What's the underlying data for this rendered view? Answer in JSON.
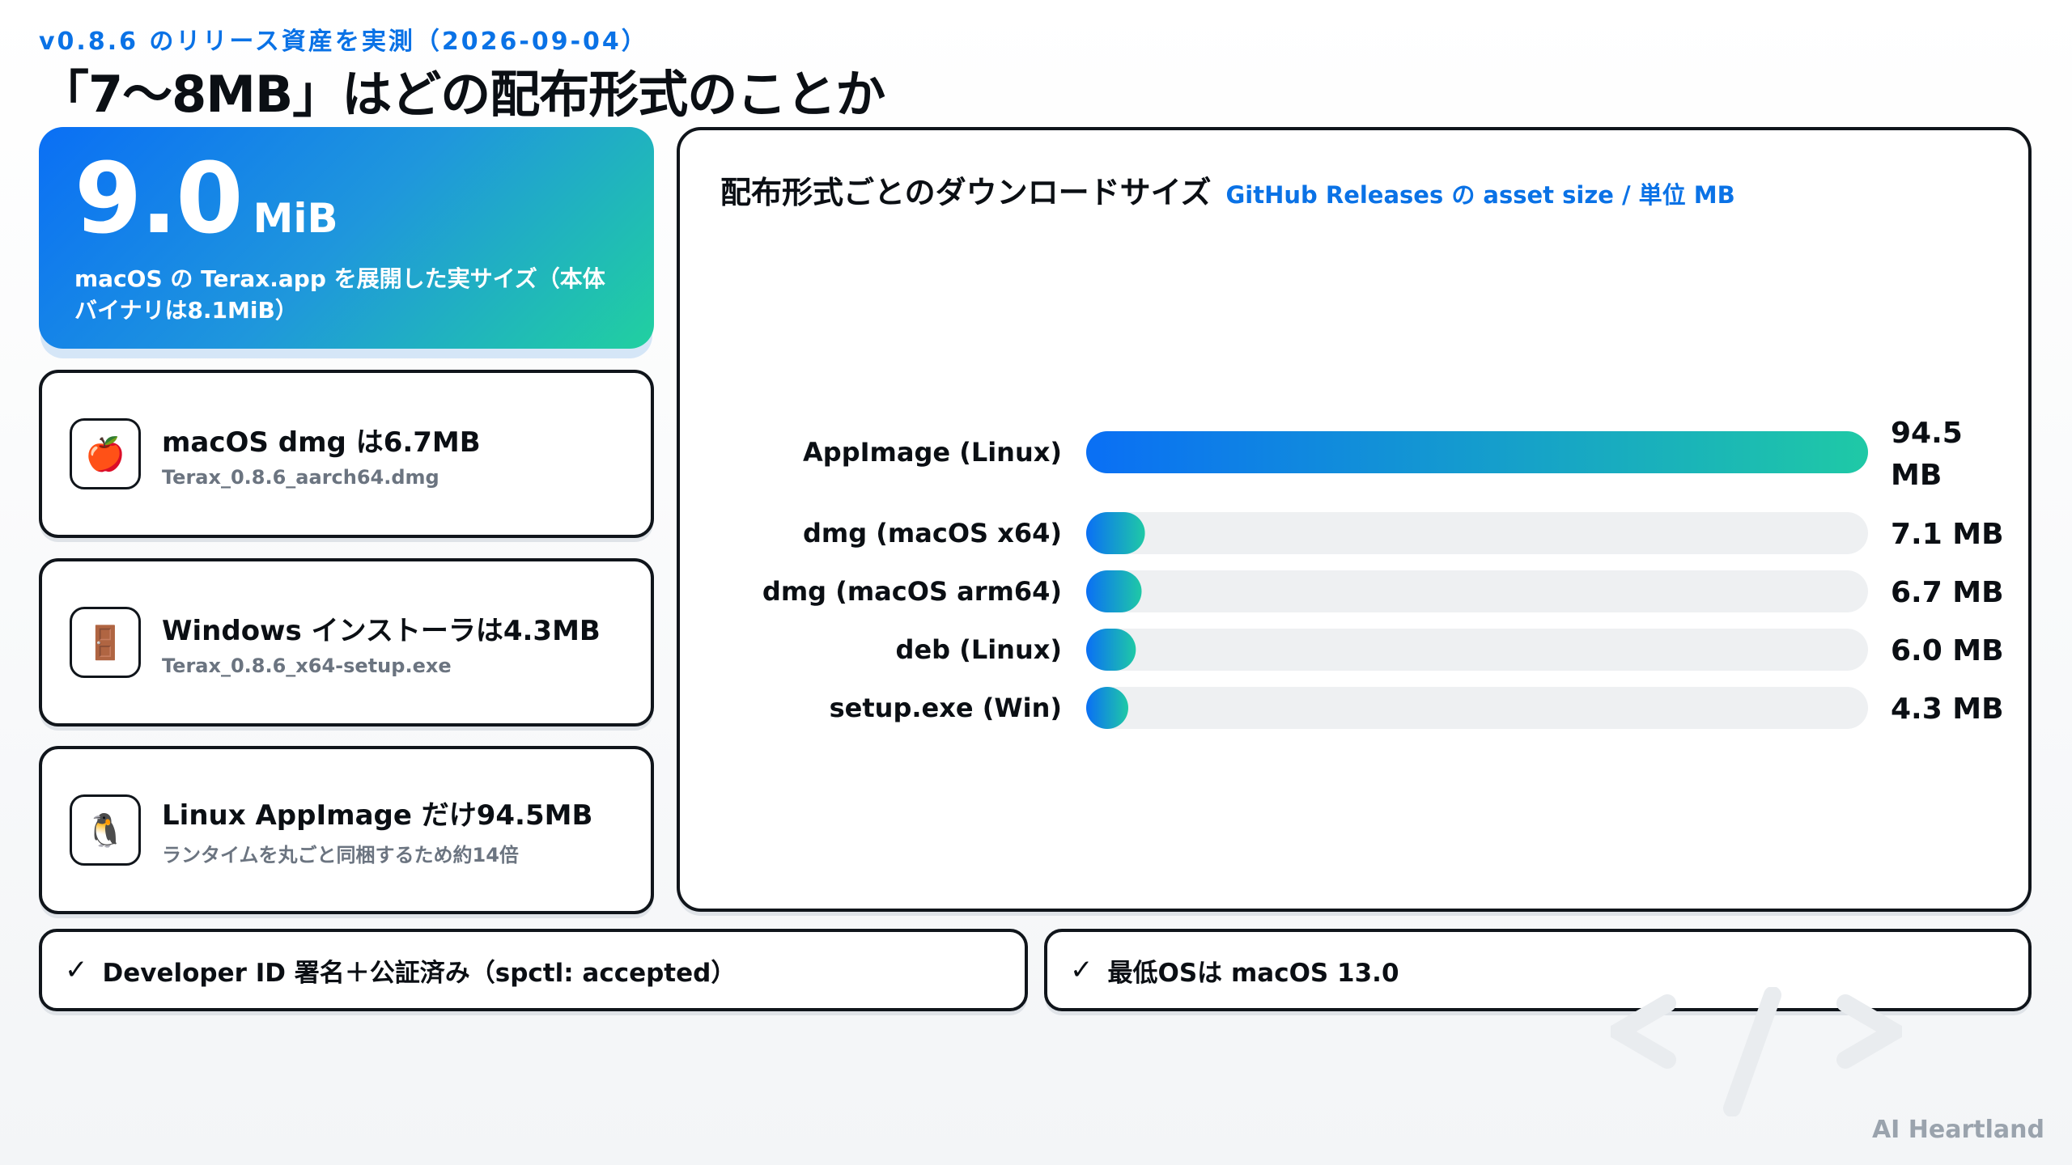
{
  "header": {
    "eyebrow": "v0.8.6 のリリース資産を実測（2026-09-04）",
    "title": "「7〜8MB」はどの配布形式のことか"
  },
  "hero": {
    "value": "9.0",
    "unit": "MiB",
    "description": "macOS の Terax.app を展開した実サイズ（本体バイナリは8.1MiB）"
  },
  "facts": [
    {
      "icon": "apple-icon",
      "glyph": "🍎",
      "title": "macOS dmg は6.7MB",
      "subtitle": "Terax_0.8.6_aarch64.dmg"
    },
    {
      "icon": "window-icon",
      "glyph": "🚪",
      "title": "Windows インストーラは4.3MB",
      "subtitle": "Terax_0.8.6_x64-setup.exe"
    },
    {
      "icon": "penguin-icon",
      "glyph": "🐧",
      "title": "Linux AppImage だけ94.5MB",
      "subtitle": "ランタイムを丸ごと同梱するため約14倍"
    }
  ],
  "panel": {
    "title": "配布形式ごとのダウンロードサイズ",
    "subtitle": "GitHub Releases の asset size / 単位 MB"
  },
  "chart_data": {
    "type": "bar",
    "orientation": "horizontal",
    "categories": [
      "AppImage (Linux)",
      "dmg (macOS x64)",
      "dmg (macOS arm64)",
      "deb (Linux)",
      "setup.exe (Win)"
    ],
    "values": [
      94.5,
      7.1,
      6.7,
      6.0,
      4.3
    ],
    "value_labels": [
      "94.5 MB",
      "7.1 MB",
      "6.7 MB",
      "6.0 MB",
      "4.3 MB"
    ],
    "unit": "MB",
    "xlim": [
      0,
      94.5
    ],
    "grid": false,
    "colors": {
      "start": "#0a6ff5",
      "end": "#1fc9a6",
      "track": "#eef0f2"
    }
  },
  "notes": [
    {
      "check": "✓",
      "text": "Developer ID 署名＋公証済み（spctl: accepted）"
    },
    {
      "check": "✓",
      "text": "最低OSは macOS 13.0"
    }
  ],
  "watermark": "AI Heartland"
}
